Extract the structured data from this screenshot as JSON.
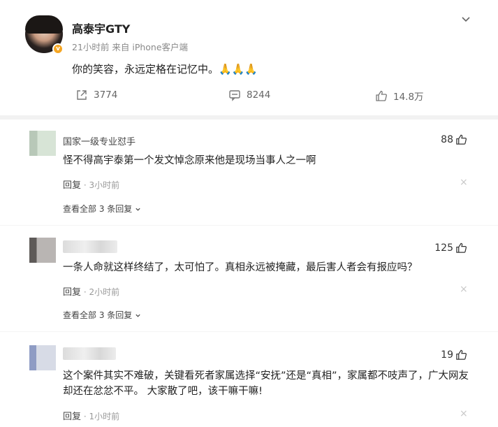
{
  "post": {
    "username": "高泰宇GTY",
    "meta": "21小时前  来自 iPhone客户端",
    "text": "你的笑容，永远定格在记忆中。🙏🙏🙏",
    "reposts": "3774",
    "comments": "8244",
    "likes": "14.8万",
    "verified_badge": "v"
  },
  "comments": [
    {
      "name": "国家一级专业怼手",
      "text": "怪不得高宇泰第一个发文悼念原来他是现场当事人之一啊",
      "reply_label": "回复",
      "time": "· 3小时前",
      "likes": "88",
      "sub_replies": "查看全部 3 条回复",
      "close": "×"
    },
    {
      "name": "",
      "text": "一条人命就这样终结了，太可怕了。真相永远被掩藏，最后害人者会有报应吗？",
      "reply_label": "回复",
      "time": "· 2小时前",
      "likes": "125",
      "sub_replies": "查看全部 3 条回复",
      "close": "×"
    },
    {
      "name": "",
      "text": "这个案件其实不难破，关键看死者家属选择“安抚”还是“真相”，家属都不吱声了，广大网友却还在忿忿不平。 大家散了吧，该干嘛干嘛!",
      "reply_label": "回复",
      "time": "· 1小时前",
      "likes": "19",
      "close": "×"
    }
  ],
  "colors": {
    "verified": "#f5a623",
    "text": "#222222",
    "muted": "#999999"
  },
  "icons": [
    "chevron-down-icon",
    "repost-icon",
    "comment-icon",
    "like-icon",
    "close-icon",
    "chevron-down-small-icon"
  ]
}
